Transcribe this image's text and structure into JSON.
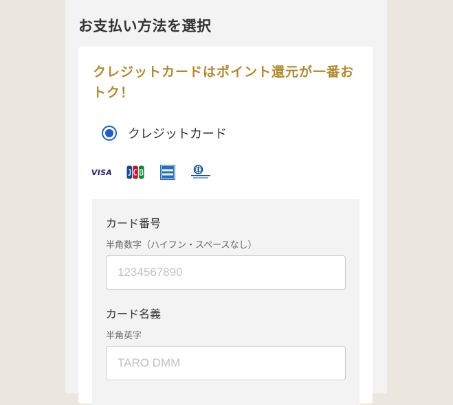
{
  "section": {
    "title": "お支払い方法を選択"
  },
  "promo": {
    "text": "クレジットカードはポイント還元が一番おトク！",
    "color": "#b5882a"
  },
  "payment_option": {
    "label": "クレジットカード",
    "selected": true,
    "accent_color": "#1d5bd1"
  },
  "card_brands": [
    {
      "icon": "visa-logo",
      "text": "VISA"
    },
    {
      "icon": "jcb-logo",
      "text": "JCB"
    },
    {
      "icon": "amex-logo",
      "text": "AMERICAN EXPRESS"
    },
    {
      "icon": "diners-club-logo",
      "text": "Diners Club INTERNATIONAL"
    }
  ],
  "form": {
    "card_number": {
      "label": "カード番号",
      "hint": "半角数字（ハイフン・スペースなし）",
      "value": "",
      "placeholder": "1234567890"
    },
    "card_name": {
      "label": "カード名義",
      "hint": "半角英字",
      "value": "",
      "placeholder": "TARO DMM"
    }
  }
}
